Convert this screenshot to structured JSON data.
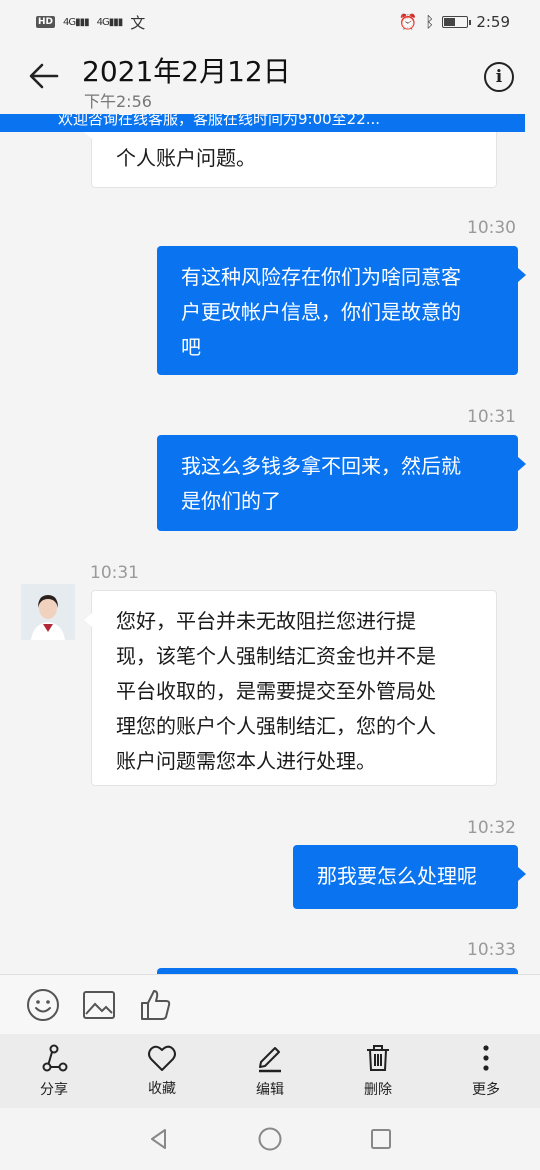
{
  "status_bar": {
    "left_badges": [
      "HD",
      "4G",
      "4G",
      "文"
    ],
    "time": "2:59"
  },
  "header": {
    "title": "2021年2月12日",
    "subtitle": "下午2:56"
  },
  "banner": {
    "text": "欢迎咨询在线客服，客服在线时间为9:00至22..."
  },
  "messages": [
    {
      "side": "in",
      "lines": [
        "个人账户问题。"
      ]
    },
    {
      "side": "out",
      "time": "10:30",
      "lines": [
        "有这种风险存在你们为啥同意客",
        "户更改帐户信息，你们是故意的",
        "吧"
      ]
    },
    {
      "side": "out",
      "time": "10:31",
      "lines": [
        "我这么多钱多拿不回来，然后就",
        "是你们的了"
      ]
    },
    {
      "side": "in",
      "time": "10:31",
      "lines": [
        "您好，平台并未无故阻拦您进行提",
        "现，该笔个人强制结汇资金也并不是",
        "平台收取的，是需要提交至外管局处",
        "理您的账户个人强制结汇，您的个人",
        "账户问题需您本人进行处理。"
      ]
    },
    {
      "side": "out",
      "time": "10:32",
      "lines": [
        "那我要怎么处理呢"
      ]
    },
    {
      "side": "out",
      "time": "10:33",
      "lines": [
        ""
      ]
    }
  ],
  "quickbar": {
    "icons": [
      "emoji-icon",
      "image-icon",
      "thumbs-up-icon"
    ]
  },
  "toolbar": {
    "share": "分享",
    "favorite": "收藏",
    "edit": "编辑",
    "delete": "删除",
    "more": "更多"
  },
  "colors": {
    "accent": "#0a74f0",
    "background": "#f4f4f4"
  }
}
